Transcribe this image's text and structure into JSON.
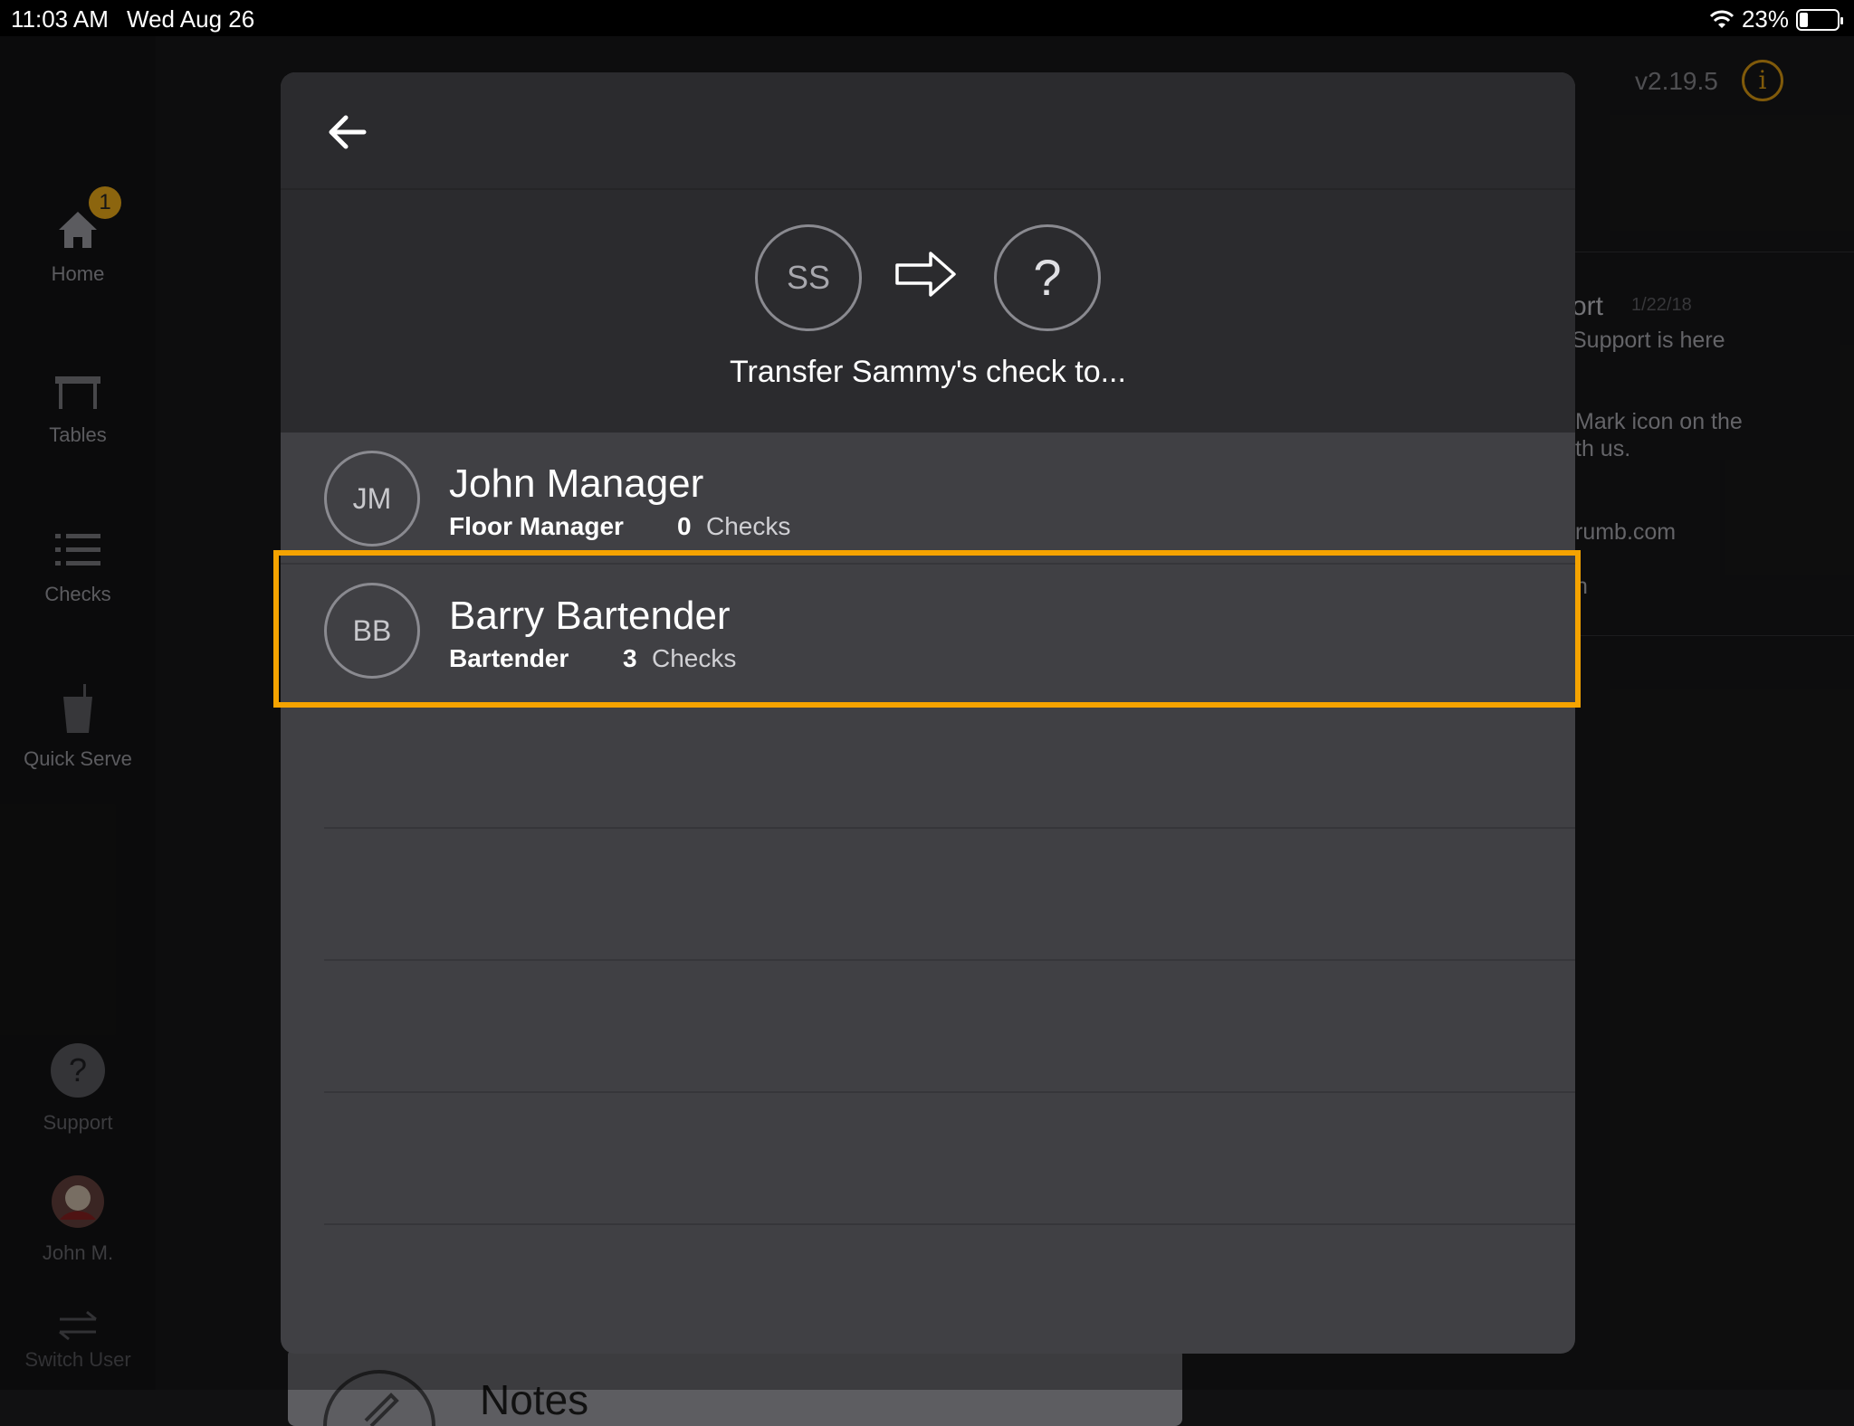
{
  "status_bar": {
    "time": "11:03 AM",
    "date": "Wed Aug 26",
    "battery": "23%",
    "battery_level": 0.23,
    "wifi_icon": "wifi-icon"
  },
  "sidebar": {
    "items": [
      {
        "label": "Home",
        "icon": "home-icon",
        "badge": "1"
      },
      {
        "label": "Tables",
        "icon": "table-icon"
      },
      {
        "label": "Checks",
        "icon": "list-icon"
      },
      {
        "label": "Quick Serve",
        "icon": "cup-icon"
      },
      {
        "label": "Support",
        "icon": "help-icon"
      },
      {
        "label": "John M.",
        "icon": "avatar"
      },
      {
        "label": "Switch User",
        "icon": "swap-icon"
      }
    ]
  },
  "background": {
    "version": "v2.19.5",
    "panel_lines": [
      "ort",
      "1/22/18",
      "Support is here",
      "Mark icon on the",
      "th us.",
      "rumb.com",
      "n"
    ],
    "notes_label": "Notes"
  },
  "modal": {
    "from_initials": "SS",
    "to_placeholder": "?",
    "title": "Transfer Sammy's check to...",
    "employees": [
      {
        "initials": "JM",
        "name": "John Manager",
        "role": "Floor Manager",
        "count": "0",
        "checks_label": "Checks"
      },
      {
        "initials": "BB",
        "name": "Barry Bartender",
        "role": "Bartender",
        "count": "3",
        "checks_label": "Checks"
      }
    ]
  },
  "colors": {
    "accent": "#f5a300",
    "modal_bg": "#404044",
    "header_bg": "#2b2b2e",
    "badge": "#d79b16"
  }
}
